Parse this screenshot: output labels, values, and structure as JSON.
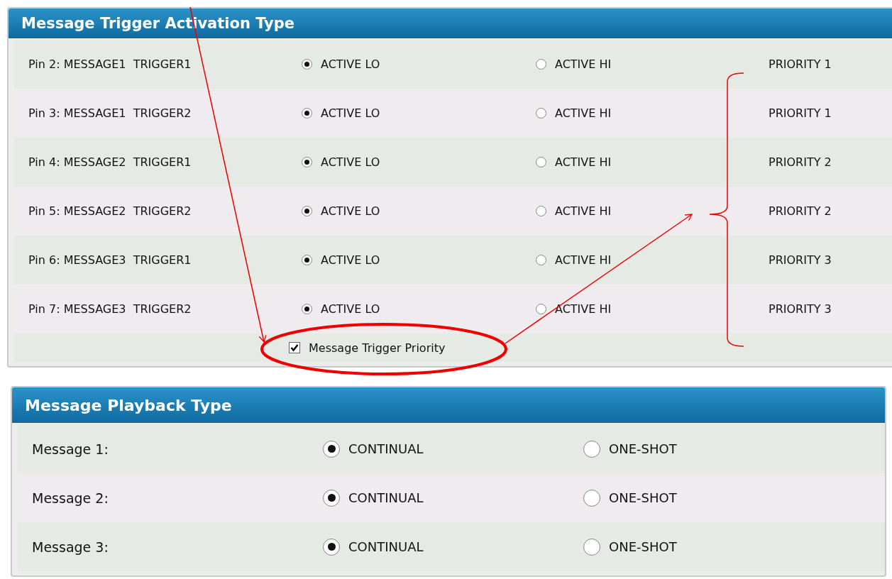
{
  "trigger_panel": {
    "title": "Message Trigger Activation Type",
    "rows": [
      {
        "label": "Pin 2: MESSAGE1  TRIGGER1",
        "options": [
          {
            "label": "ACTIVE LO",
            "selected": true
          },
          {
            "label": "ACTIVE HI",
            "selected": false
          }
        ],
        "priority": "PRIORITY 1"
      },
      {
        "label": "Pin 3: MESSAGE1  TRIGGER2",
        "options": [
          {
            "label": "ACTIVE LO",
            "selected": true
          },
          {
            "label": "ACTIVE HI",
            "selected": false
          }
        ],
        "priority": "PRIORITY 1"
      },
      {
        "label": "Pin 4: MESSAGE2  TRIGGER1",
        "options": [
          {
            "label": "ACTIVE LO",
            "selected": true
          },
          {
            "label": "ACTIVE HI",
            "selected": false
          }
        ],
        "priority": "PRIORITY 2"
      },
      {
        "label": "Pin 5: MESSAGE2  TRIGGER2",
        "options": [
          {
            "label": "ACTIVE LO",
            "selected": true
          },
          {
            "label": "ACTIVE HI",
            "selected": false
          }
        ],
        "priority": "PRIORITY 2"
      },
      {
        "label": "Pin 6: MESSAGE3  TRIGGER1",
        "options": [
          {
            "label": "ACTIVE LO",
            "selected": true
          },
          {
            "label": "ACTIVE HI",
            "selected": false
          }
        ],
        "priority": "PRIORITY 3"
      },
      {
        "label": "Pin 7: MESSAGE3  TRIGGER2",
        "options": [
          {
            "label": "ACTIVE LO",
            "selected": true
          },
          {
            "label": "ACTIVE HI",
            "selected": false
          }
        ],
        "priority": "PRIORITY 3"
      }
    ],
    "priority_checkbox": {
      "label": "Message Trigger Priority",
      "checked": true
    }
  },
  "playback_panel": {
    "title": "Message Playback Type",
    "rows": [
      {
        "label": "Message 1:",
        "options": [
          {
            "label": "CONTINUAL",
            "selected": true
          },
          {
            "label": "ONE-SHOT",
            "selected": false
          }
        ]
      },
      {
        "label": "Message 2:",
        "options": [
          {
            "label": "CONTINUAL",
            "selected": true
          },
          {
            "label": "ONE-SHOT",
            "selected": false
          }
        ]
      },
      {
        "label": "Message 3:",
        "options": [
          {
            "label": "CONTINUAL",
            "selected": true
          },
          {
            "label": "ONE-SHOT",
            "selected": false
          }
        ]
      }
    ]
  }
}
